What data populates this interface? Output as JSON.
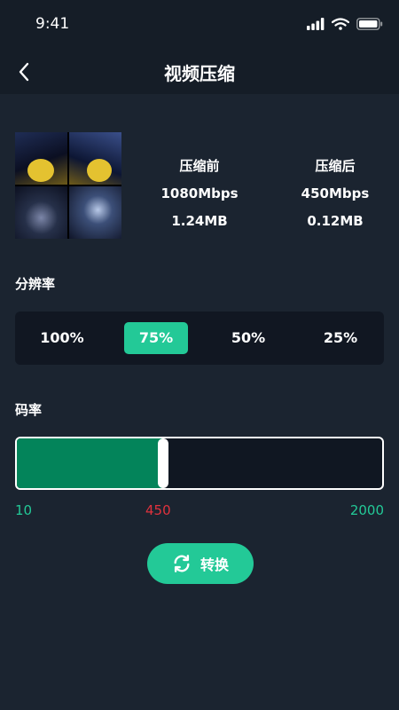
{
  "status_bar": {
    "time": "9:41"
  },
  "header": {
    "title": "视频压缩",
    "back_icon": "back-arrow-icon"
  },
  "comparison": {
    "before": {
      "label": "压缩前",
      "bitrate": "1080Mbps",
      "size": "1.24MB"
    },
    "after": {
      "label": "压缩后",
      "bitrate": "450Mbps",
      "size": "0.12MB"
    }
  },
  "resolution": {
    "label": "分辨率",
    "options": [
      "100%",
      "75%",
      "50%",
      "25%"
    ],
    "selected": "75%"
  },
  "bitrate": {
    "label": "码率",
    "min": "10",
    "current": "450",
    "max": "2000",
    "fill_fraction": 0.4
  },
  "convert_button": {
    "label": "转换",
    "icon": "refresh-icon"
  },
  "colors": {
    "background": "#1b2430",
    "header": "#151d27",
    "accent": "#23c997",
    "slider_fill": "#03845a",
    "current_value": "#e0323d",
    "range_label": "#23c997"
  }
}
